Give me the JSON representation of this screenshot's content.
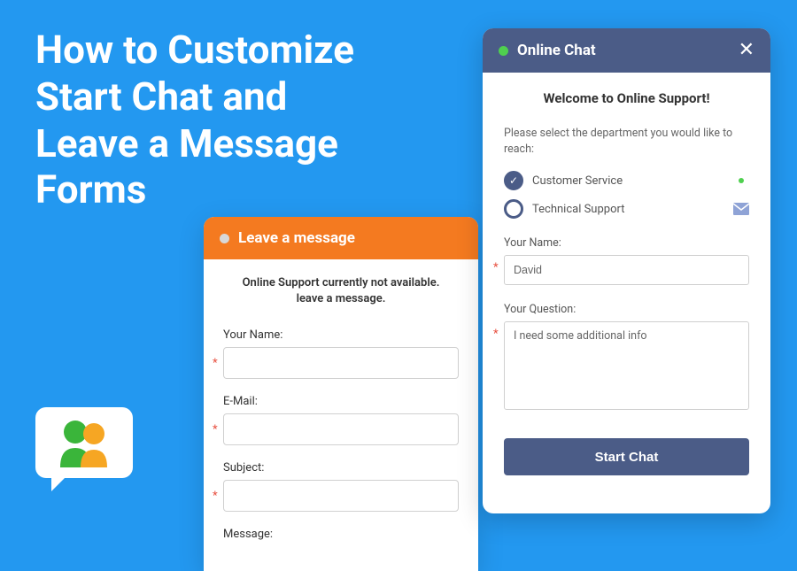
{
  "heading": "How to Customize Start Chat and Leave a Message Forms",
  "leave_message": {
    "title": "Leave a message",
    "notice_line1": "Online Support currently not available.",
    "notice_line2": "leave a message.",
    "fields": {
      "name_label": "Your Name:",
      "email_label": "E-Mail:",
      "subject_label": "Subject:",
      "message_label": "Message:"
    }
  },
  "online_chat": {
    "title": "Online Chat",
    "welcome": "Welcome to Online Support!",
    "instruction": "Please select the department you would like to reach:",
    "departments": [
      {
        "label": "Customer Service",
        "selected": true,
        "status": "online"
      },
      {
        "label": "Technical Support",
        "selected": false,
        "status": "mail"
      }
    ],
    "name_label": "Your Name:",
    "name_value": "David",
    "question_label": "Your Question:",
    "question_value": "I need some additional info",
    "start_button": "Start Chat"
  }
}
